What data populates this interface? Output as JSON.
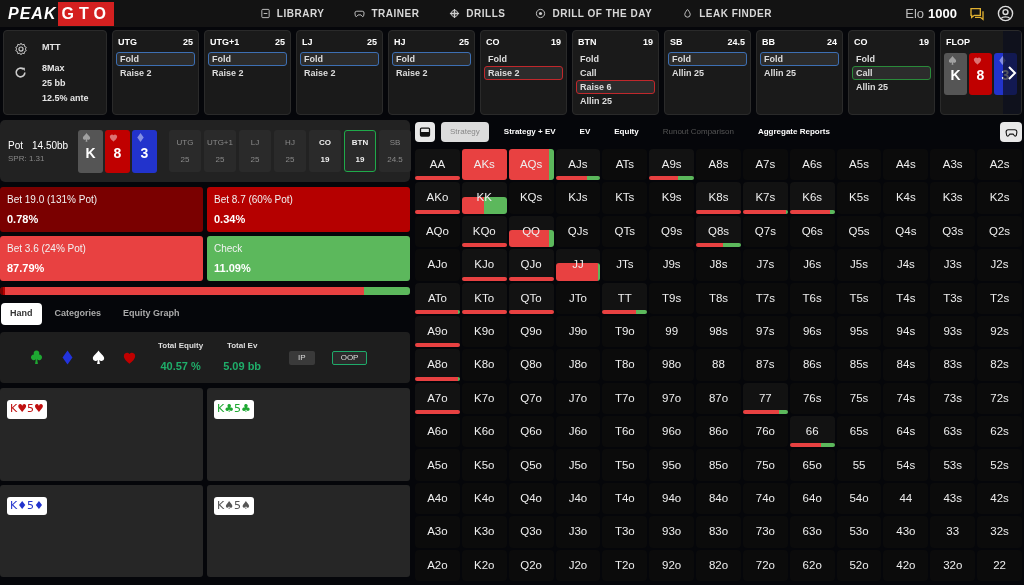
{
  "header": {
    "logo": {
      "word": "PEAK",
      "boxed": "GTO"
    },
    "nav": [
      {
        "label": "LIBRARY"
      },
      {
        "label": "TRAINER"
      },
      {
        "label": "DRILLS"
      },
      {
        "label": "DRILL OF THE DAY"
      },
      {
        "label": "LEAK FINDER"
      }
    ],
    "elo": {
      "label": "Elo",
      "value": "1000"
    }
  },
  "game_info": {
    "format": "MTT",
    "lines": [
      "8Max",
      "25 bb",
      "12.5% ante"
    ]
  },
  "positions": [
    {
      "name": "UTG",
      "stack": "25",
      "actions": [
        {
          "label": "Fold",
          "kind": "fold",
          "selected": true
        },
        {
          "label": "Raise 2",
          "selected": false
        }
      ]
    },
    {
      "name": "UTG+1",
      "stack": "25",
      "actions": [
        {
          "label": "Fold",
          "kind": "fold",
          "selected": true
        },
        {
          "label": "Raise 2",
          "selected": false
        }
      ]
    },
    {
      "name": "LJ",
      "stack": "25",
      "actions": [
        {
          "label": "Fold",
          "kind": "fold",
          "selected": true
        },
        {
          "label": "Raise 2",
          "selected": false
        }
      ]
    },
    {
      "name": "HJ",
      "stack": "25",
      "actions": [
        {
          "label": "Fold",
          "kind": "fold",
          "selected": true
        },
        {
          "label": "Raise 2",
          "selected": false
        }
      ]
    },
    {
      "name": "CO",
      "stack": "19",
      "actions": [
        {
          "label": "Fold",
          "selected": false
        },
        {
          "label": "Raise 2",
          "kind": "raise",
          "selected": true
        }
      ]
    },
    {
      "name": "BTN",
      "stack": "19",
      "actions": [
        {
          "label": "Fold",
          "selected": false
        },
        {
          "label": "Call",
          "selected": false
        },
        {
          "label": "Raise 6",
          "kind": "raise",
          "selected": true
        },
        {
          "label": "Allin 25",
          "selected": false
        }
      ]
    },
    {
      "name": "SB",
      "stack": "24.5",
      "actions": [
        {
          "label": "Fold",
          "kind": "fold",
          "selected": true
        },
        {
          "label": "Allin 25",
          "selected": false
        }
      ]
    },
    {
      "name": "BB",
      "stack": "24",
      "actions": [
        {
          "label": "Fold",
          "kind": "fold",
          "selected": true
        },
        {
          "label": "Allin 25",
          "selected": false
        }
      ]
    },
    {
      "name": "CO",
      "stack": "19",
      "actions": [
        {
          "label": "Fold",
          "selected": false
        },
        {
          "label": "Call",
          "kind": "call",
          "selected": true
        },
        {
          "label": "Allin 25",
          "selected": false
        }
      ]
    }
  ],
  "flop": {
    "title": "FLOP",
    "cards": [
      {
        "rank": "K",
        "kind": "spade"
      },
      {
        "rank": "8",
        "kind": "heart"
      },
      {
        "rank": "3",
        "kind": "diamond"
      }
    ]
  },
  "board": {
    "pot_label": "Pot",
    "pot": "14.50bb",
    "spr": "SPR: 1.31",
    "cards": [
      {
        "rank": "K",
        "kind": "spade"
      },
      {
        "rank": "8",
        "kind": "heart"
      },
      {
        "rank": "3",
        "kind": "diamond"
      }
    ],
    "seats": [
      {
        "name": "UTG",
        "stack": "25",
        "disabled": true,
        "selected": false
      },
      {
        "name": "UTG+1",
        "stack": "25",
        "disabled": true,
        "selected": false
      },
      {
        "name": "LJ",
        "stack": "25",
        "disabled": true,
        "selected": false
      },
      {
        "name": "HJ",
        "stack": "25",
        "disabled": true,
        "selected": false
      },
      {
        "name": "CO",
        "stack": "19",
        "disabled": false,
        "selected": false
      },
      {
        "name": "BTN",
        "stack": "19",
        "disabled": false,
        "selected": true
      },
      {
        "name": "SB",
        "stack": "24.5",
        "disabled": true,
        "selected": false
      }
    ]
  },
  "actions": [
    {
      "label": "Bet 19.0 (131% Pot)",
      "share": "0.78%",
      "color": "#7a0000"
    },
    {
      "label": "Bet 8.7 (60% Pot)",
      "share": "0.34%",
      "color": "#b50000"
    },
    {
      "label": "Bet 3.6 (24% Pot)",
      "share": "87.79%",
      "color": "#e84141"
    },
    {
      "label": "Check",
      "share": "11.09%",
      "color": "#5cb85c"
    }
  ],
  "strategy_bar": [
    {
      "color": "#7a0000",
      "level": 0.008
    },
    {
      "color": "#b50000",
      "level": 0.004
    },
    {
      "color": "#e84141",
      "level": 0.877
    },
    {
      "color": "#5cb85c",
      "level": 0.111
    }
  ],
  "left_tabs": [
    {
      "label": "Hand",
      "selected": true
    },
    {
      "label": "Categories",
      "selected": false
    },
    {
      "label": "Equity Graph",
      "selected": false
    }
  ],
  "equity": {
    "equity_label": "Total Equity",
    "equity": "40.57 %",
    "ev_label": "Total Ev",
    "ev": "5.09 bb",
    "sides": [
      {
        "label": "IP",
        "selected": false
      },
      {
        "label": "OOP",
        "selected": true
      }
    ]
  },
  "combos": [
    {
      "text": "K♥5♥",
      "kind": "heart"
    },
    {
      "text": "K♣5♣",
      "kind": "club"
    },
    {
      "text": "K♦5♦",
      "kind": "diamond"
    },
    {
      "text": "K♠5♠",
      "kind": "spade"
    }
  ],
  "view_tabs": [
    {
      "label": "Strategy",
      "selected": true,
      "disabled": false
    },
    {
      "label": "Strategy + EV",
      "selected": false,
      "disabled": false
    },
    {
      "label": "EV",
      "selected": false,
      "disabled": false
    },
    {
      "label": "Equity",
      "selected": false,
      "disabled": false
    },
    {
      "label": "Runout Comparison",
      "selected": false,
      "disabled": true
    },
    {
      "label": "Aggregate Reports",
      "selected": false,
      "disabled": false
    }
  ],
  "grid": [
    [
      {
        "hand": "AA",
        "kind": "bar",
        "mix": [
          {
            "kind": "bet",
            "level": 1
          }
        ]
      },
      {
        "hand": "AKs",
        "kind": "full",
        "mix": [
          {
            "kind": "bet",
            "level": 1
          }
        ]
      },
      {
        "hand": "AQs",
        "kind": "full",
        "mix": [
          {
            "kind": "bet",
            "level": 0.9
          },
          {
            "kind": "check",
            "level": 0.1
          }
        ]
      },
      {
        "hand": "AJs",
        "kind": "bar",
        "mix": [
          {
            "kind": "bet",
            "level": 0.7
          },
          {
            "kind": "check",
            "level": 0.3
          }
        ]
      },
      {
        "hand": "ATs"
      },
      {
        "hand": "A9s",
        "kind": "bar",
        "mix": [
          {
            "kind": "bet",
            "level": 0.65
          },
          {
            "kind": "check",
            "level": 0.35
          }
        ]
      },
      {
        "hand": "A8s"
      },
      {
        "hand": "A7s"
      },
      {
        "hand": "A6s"
      },
      {
        "hand": "A5s"
      },
      {
        "hand": "A4s"
      },
      {
        "hand": "A3s"
      },
      {
        "hand": "A2s"
      }
    ],
    [
      {
        "hand": "AKo",
        "kind": "bar",
        "mix": [
          {
            "kind": "bet",
            "level": 1
          }
        ]
      },
      {
        "hand": "KK",
        "kind": "half",
        "mix": [
          {
            "kind": "bet",
            "level": 0.5
          },
          {
            "kind": "check",
            "level": 0.5
          }
        ]
      },
      {
        "hand": "KQs"
      },
      {
        "hand": "KJs"
      },
      {
        "hand": "KTs"
      },
      {
        "hand": "K9s"
      },
      {
        "hand": "K8s",
        "kind": "bar",
        "mix": [
          {
            "kind": "bet",
            "level": 1
          }
        ]
      },
      {
        "hand": "K7s",
        "kind": "bar",
        "mix": [
          {
            "kind": "bet",
            "level": 0.97
          },
          {
            "kind": "check",
            "level": 0.03
          }
        ]
      },
      {
        "hand": "K6s",
        "kind": "bar",
        "mix": [
          {
            "kind": "bet",
            "level": 0.9
          },
          {
            "kind": "check",
            "level": 0.1
          }
        ]
      },
      {
        "hand": "K5s"
      },
      {
        "hand": "K4s"
      },
      {
        "hand": "K3s"
      },
      {
        "hand": "K2s"
      }
    ],
    [
      {
        "hand": "AQo"
      },
      {
        "hand": "KQo",
        "kind": "bar",
        "mix": [
          {
            "kind": "bet",
            "level": 1
          }
        ]
      },
      {
        "hand": "QQ",
        "kind": "half",
        "mix": [
          {
            "kind": "bet",
            "level": 0.9
          },
          {
            "kind": "check",
            "level": 0.1
          }
        ]
      },
      {
        "hand": "QJs"
      },
      {
        "hand": "QTs"
      },
      {
        "hand": "Q9s"
      },
      {
        "hand": "Q8s",
        "kind": "bar",
        "mix": [
          {
            "kind": "bet",
            "level": 0.6
          },
          {
            "kind": "check",
            "level": 0.4
          }
        ]
      },
      {
        "hand": "Q7s"
      },
      {
        "hand": "Q6s"
      },
      {
        "hand": "Q5s"
      },
      {
        "hand": "Q4s"
      },
      {
        "hand": "Q3s"
      },
      {
        "hand": "Q2s"
      }
    ],
    [
      {
        "hand": "AJo"
      },
      {
        "hand": "KJo",
        "kind": "bar",
        "mix": [
          {
            "kind": "bet",
            "level": 1
          }
        ]
      },
      {
        "hand": "QJo",
        "kind": "bar",
        "mix": [
          {
            "kind": "bet",
            "level": 1
          }
        ]
      },
      {
        "hand": "JJ",
        "kind": "half",
        "mix": [
          {
            "kind": "bet",
            "level": 0.95
          },
          {
            "kind": "check",
            "level": 0.05
          }
        ]
      },
      {
        "hand": "JTs"
      },
      {
        "hand": "J9s"
      },
      {
        "hand": "J8s"
      },
      {
        "hand": "J7s"
      },
      {
        "hand": "J6s"
      },
      {
        "hand": "J5s"
      },
      {
        "hand": "J4s"
      },
      {
        "hand": "J3s"
      },
      {
        "hand": "J2s"
      }
    ],
    [
      {
        "hand": "ATo",
        "kind": "bar",
        "mix": [
          {
            "kind": "bet",
            "level": 0.95
          },
          {
            "kind": "check",
            "level": 0.05
          }
        ]
      },
      {
        "hand": "KTo",
        "kind": "bar",
        "mix": [
          {
            "kind": "bet",
            "level": 1
          }
        ]
      },
      {
        "hand": "QTo",
        "kind": "bar",
        "mix": [
          {
            "kind": "bet",
            "level": 1
          }
        ]
      },
      {
        "hand": "JTo"
      },
      {
        "hand": "TT",
        "kind": "bar",
        "mix": [
          {
            "kind": "bet",
            "level": 0.75
          },
          {
            "kind": "check",
            "level": 0.25
          }
        ]
      },
      {
        "hand": "T9s"
      },
      {
        "hand": "T8s"
      },
      {
        "hand": "T7s"
      },
      {
        "hand": "T6s"
      },
      {
        "hand": "T5s"
      },
      {
        "hand": "T4s"
      },
      {
        "hand": "T3s"
      },
      {
        "hand": "T2s"
      }
    ],
    [
      {
        "hand": "A9o",
        "kind": "bar",
        "mix": [
          {
            "kind": "bet",
            "level": 1
          }
        ]
      },
      {
        "hand": "K9o"
      },
      {
        "hand": "Q9o"
      },
      {
        "hand": "J9o"
      },
      {
        "hand": "T9o"
      },
      {
        "hand": "99"
      },
      {
        "hand": "98s"
      },
      {
        "hand": "97s"
      },
      {
        "hand": "96s"
      },
      {
        "hand": "95s"
      },
      {
        "hand": "94s"
      },
      {
        "hand": "93s"
      },
      {
        "hand": "92s"
      }
    ],
    [
      {
        "hand": "A8o",
        "kind": "bar",
        "mix": [
          {
            "kind": "bet",
            "level": 0.96
          },
          {
            "kind": "check",
            "level": 0.04
          }
        ]
      },
      {
        "hand": "K8o"
      },
      {
        "hand": "Q8o"
      },
      {
        "hand": "J8o"
      },
      {
        "hand": "T8o"
      },
      {
        "hand": "98o"
      },
      {
        "hand": "88"
      },
      {
        "hand": "87s"
      },
      {
        "hand": "86s"
      },
      {
        "hand": "85s"
      },
      {
        "hand": "84s"
      },
      {
        "hand": "83s"
      },
      {
        "hand": "82s"
      }
    ],
    [
      {
        "hand": "A7o",
        "kind": "bar",
        "mix": [
          {
            "kind": "bet",
            "level": 1
          }
        ]
      },
      {
        "hand": "K7o"
      },
      {
        "hand": "Q7o"
      },
      {
        "hand": "J7o"
      },
      {
        "hand": "T7o"
      },
      {
        "hand": "97o"
      },
      {
        "hand": "87o"
      },
      {
        "hand": "77",
        "kind": "bar",
        "mix": [
          {
            "kind": "bet",
            "level": 0.8
          },
          {
            "kind": "check",
            "level": 0.2
          }
        ]
      },
      {
        "hand": "76s"
      },
      {
        "hand": "75s"
      },
      {
        "hand": "74s"
      },
      {
        "hand": "73s"
      },
      {
        "hand": "72s"
      }
    ],
    [
      {
        "hand": "A6o"
      },
      {
        "hand": "K6o"
      },
      {
        "hand": "Q6o"
      },
      {
        "hand": "J6o"
      },
      {
        "hand": "T6o"
      },
      {
        "hand": "96o"
      },
      {
        "hand": "86o"
      },
      {
        "hand": "76o"
      },
      {
        "hand": "66",
        "kind": "bar",
        "mix": [
          {
            "kind": "bet",
            "level": 0.7
          },
          {
            "kind": "check",
            "level": 0.3
          }
        ]
      },
      {
        "hand": "65s"
      },
      {
        "hand": "64s"
      },
      {
        "hand": "63s"
      },
      {
        "hand": "62s"
      }
    ],
    [
      {
        "hand": "A5o"
      },
      {
        "hand": "K5o"
      },
      {
        "hand": "Q5o"
      },
      {
        "hand": "J5o"
      },
      {
        "hand": "T5o"
      },
      {
        "hand": "95o"
      },
      {
        "hand": "85o"
      },
      {
        "hand": "75o"
      },
      {
        "hand": "65o"
      },
      {
        "hand": "55"
      },
      {
        "hand": "54s"
      },
      {
        "hand": "53s"
      },
      {
        "hand": "52s"
      }
    ],
    [
      {
        "hand": "A4o"
      },
      {
        "hand": "K4o"
      },
      {
        "hand": "Q4o"
      },
      {
        "hand": "J4o"
      },
      {
        "hand": "T4o"
      },
      {
        "hand": "94o"
      },
      {
        "hand": "84o"
      },
      {
        "hand": "74o"
      },
      {
        "hand": "64o"
      },
      {
        "hand": "54o"
      },
      {
        "hand": "44"
      },
      {
        "hand": "43s"
      },
      {
        "hand": "42s"
      }
    ],
    [
      {
        "hand": "A3o"
      },
      {
        "hand": "K3o"
      },
      {
        "hand": "Q3o"
      },
      {
        "hand": "J3o"
      },
      {
        "hand": "T3o"
      },
      {
        "hand": "93o"
      },
      {
        "hand": "83o"
      },
      {
        "hand": "73o"
      },
      {
        "hand": "63o"
      },
      {
        "hand": "53o"
      },
      {
        "hand": "43o"
      },
      {
        "hand": "33"
      },
      {
        "hand": "32s"
      }
    ],
    [
      {
        "hand": "A2o"
      },
      {
        "hand": "K2o"
      },
      {
        "hand": "Q2o"
      },
      {
        "hand": "J2o"
      },
      {
        "hand": "T2o"
      },
      {
        "hand": "92o"
      },
      {
        "hand": "82o"
      },
      {
        "hand": "72o"
      },
      {
        "hand": "62o"
      },
      {
        "hand": "52o"
      },
      {
        "hand": "42o"
      },
      {
        "hand": "32o"
      },
      {
        "hand": "22"
      }
    ]
  ]
}
